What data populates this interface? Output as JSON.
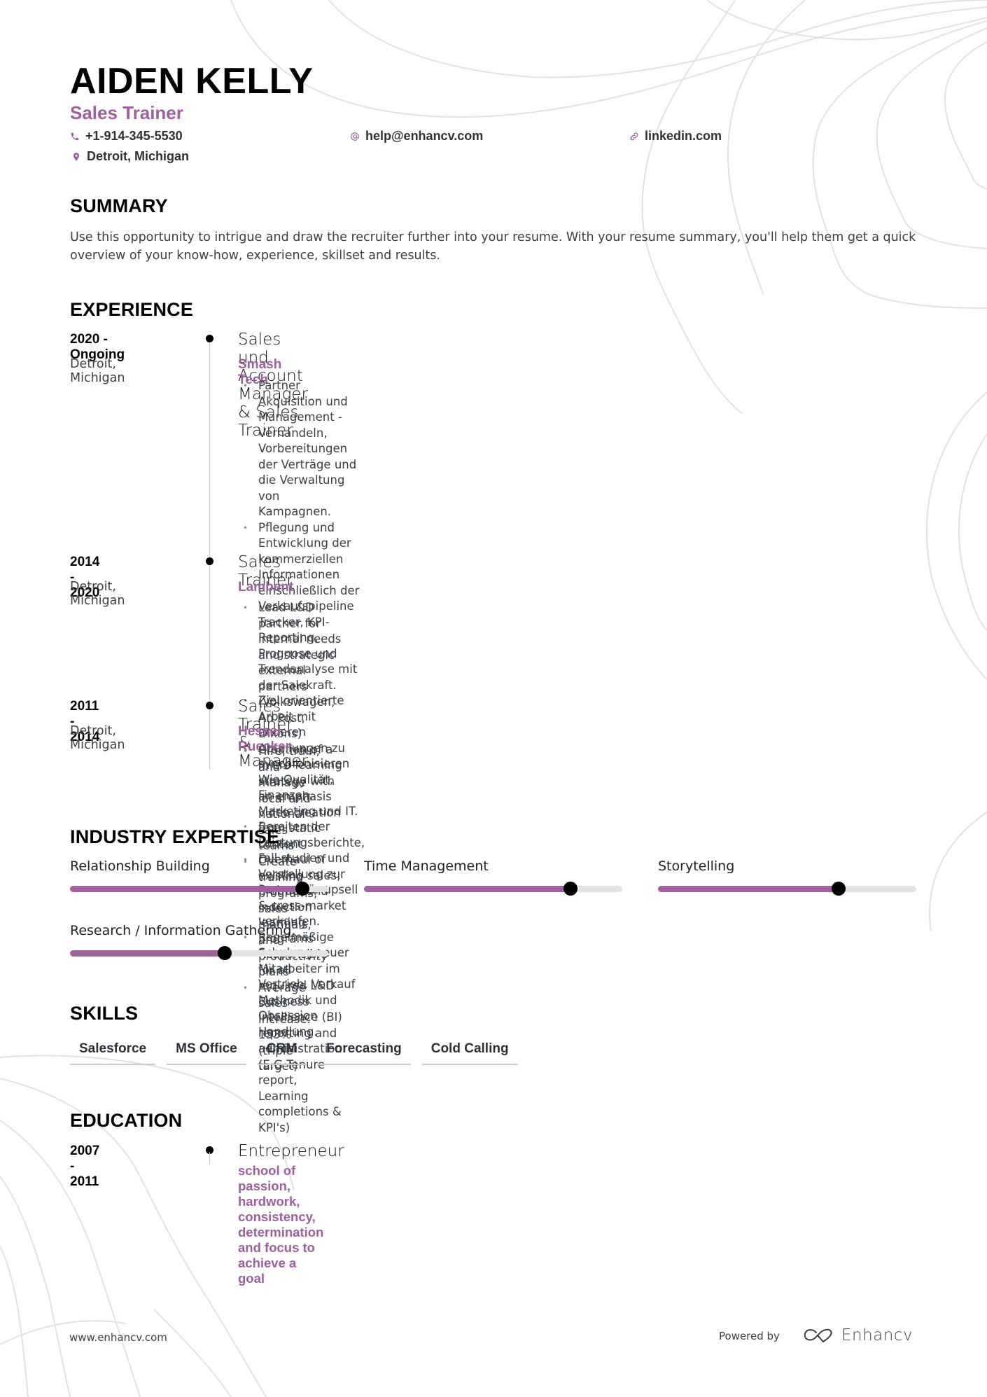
{
  "header": {
    "name": "AIDEN KELLY",
    "role": "Sales Trainer",
    "contacts": {
      "phone": "+1-914-345-5530",
      "email": "help@enhancv.com",
      "link": "linkedin.com",
      "location": "Detroit, Michigan"
    },
    "icons": {
      "phone": "phone-icon",
      "email": "at-icon",
      "link": "link-icon",
      "location": "map-pin-icon"
    }
  },
  "accent_color": "#9e5f9e",
  "summary": {
    "title": "SUMMARY",
    "text": "Use this opportunity to intrigue and draw the recruiter further into your resume. With your resume summary, you'll help them get a quick overview of your know-how, experience, skillset and results."
  },
  "experience": {
    "title": "EXPERIENCE",
    "items": [
      {
        "dates": "2020 - Ongoing",
        "location": "Detroit, Michigan",
        "title": "Sales und Account Manager & Sales Trainer",
        "company": "Smash Tech",
        "bullets": [
          "Partner Akquisition und Management - Verhandeln, Vorbereitungen der Verträge und die Verwaltung von\nKampagnen.",
          "Pflegung und Entwicklung  der kommerziellen Informationen einschließlich der Verkaufspipeline Tracker, KPI-\nReporting, Prognose und Trendanalyse mit der Salekraft.",
          " Ziel orientierte Arbeit  mit anderen Abteilungen zu synchronisieren\nWie Qualität, Finanzen, Marketing und IT.",
          "Bereiten der Leistungsberichte, Fall studien und Vorstellung zur\nPartner für upsell & cross-market verkaufen.",
          "Regelmäßige Schulung neuer Mitarbeiter im Vertrieb, Verkauf\nMethodik und Obsession Handlung."
        ]
      },
      {
        "dates": "2014 - 2020",
        "location": "Detroit, Michigan",
        "title": "Sales Trainer",
        "company": "Lambent",
        "bullets": [
          "Lead L&D partner for internal needs and strategic external partners (Volkswagen, An Post, Dixons)",
          "Creation of a micro-learning strategy with an emphasis video creation from static content",
          "Overhaul of existing sales, product and induction learning programs",
          "Responsible for all required L&D Business Intellience (BI) reporting and administration (E.G Tenure report,\nLearning completions & KPI's)"
        ]
      },
      {
        "dates": "2011 - 2014",
        "location": "Detroit, Michigan",
        "title": "Sales Trainer & Manager",
        "company": "Hessel - Ruecker",
        "bullets": [
          "Hire, train, and manage local and national sales teams",
          "Create training programs, sales manuals, and productivity plans",
          "Average sales increase: 153% (triple target)"
        ]
      }
    ]
  },
  "expertise": {
    "title": "INDUSTRY EXPERTISE",
    "items": [
      {
        "label": "Relationship Building",
        "level": 0.9
      },
      {
        "label": "Time Management",
        "level": 0.8
      },
      {
        "label": "Storytelling",
        "level": 0.7
      },
      {
        "label": "Research / Information Gathering.",
        "level": 0.6
      }
    ]
  },
  "skills": {
    "title": "SKILLS",
    "tags": [
      "Salesforce",
      "MS Office",
      "CRM",
      "Forecasting",
      "Cold Calling"
    ]
  },
  "education": {
    "title": "EDUCATION",
    "items": [
      {
        "dates": "2007 - 2011",
        "degree": "Entrepreneur",
        "school": "school of passion, hardwork, consistency, determination and focus to achieve a goal"
      }
    ]
  },
  "footer": {
    "url": "www.enhancv.com",
    "powered_by": "Powered by",
    "brand": "Enhancv",
    "brand_icon": "enhancv-logo-icon"
  }
}
